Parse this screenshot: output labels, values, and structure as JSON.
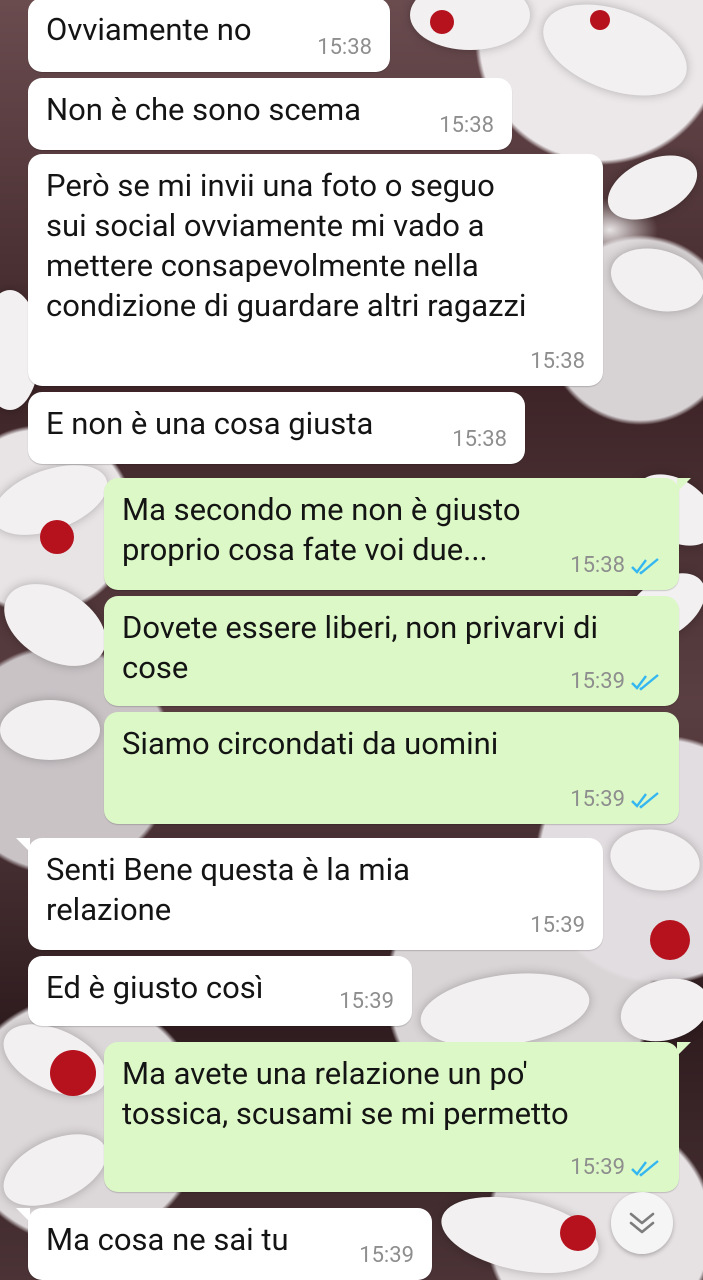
{
  "chat": {
    "messages": [
      {
        "direction": "in",
        "text": "Ovviamente no",
        "time": "15:38"
      },
      {
        "direction": "in",
        "text": "Non è che sono scema",
        "time": "15:38"
      },
      {
        "direction": "in",
        "text": "Però se mi invii una foto o seguo\nsui social ovviamente mi vado a\nmettere consapevolmente nella\ncondizione di guardare altri ragazzi",
        "time": "15:38"
      },
      {
        "direction": "in",
        "text": "E non è una cosa giusta",
        "time": "15:38"
      },
      {
        "direction": "out",
        "text": "Ma secondo me non è giusto\nproprio cosa fate voi due...",
        "time": "15:38",
        "status": "read"
      },
      {
        "direction": "out",
        "text": "Dovete essere liberi, non privarvi di\ncose",
        "time": "15:39",
        "status": "read"
      },
      {
        "direction": "out",
        "text": "Siamo circondati da uomini",
        "time": "15:39",
        "status": "read"
      },
      {
        "direction": "in",
        "text": "Senti Bene questa è la mia\nrelazione",
        "time": "15:39"
      },
      {
        "direction": "in",
        "text": "Ed è giusto così",
        "time": "15:39"
      },
      {
        "direction": "out",
        "text": "Ma avete una relazione un po'\ntossica, scusami se mi permetto",
        "time": "15:39",
        "status": "read"
      },
      {
        "direction": "in",
        "text": "Ma cosa ne sai tu",
        "time": "15:39"
      }
    ]
  },
  "scroll_button": {
    "icon": "double-chevron-down-icon"
  },
  "colors": {
    "outgoing_bubble": "#dcf8c6",
    "incoming_bubble": "#ffffff",
    "read_ticks": "#34b7f1",
    "timestamp": "#8e8e8e"
  }
}
